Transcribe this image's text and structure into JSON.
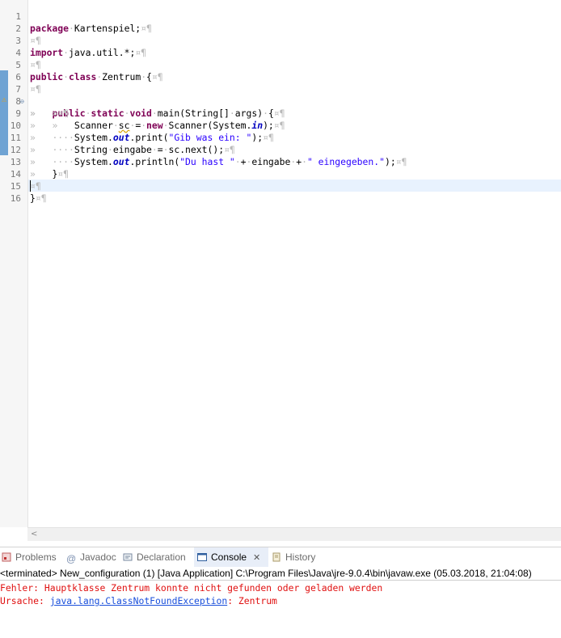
{
  "editor": {
    "lines": [
      {
        "n": "1"
      },
      {
        "n": "2"
      },
      {
        "n": "3"
      },
      {
        "n": "4"
      },
      {
        "n": "5"
      },
      {
        "n": "6"
      },
      {
        "n": "7"
      },
      {
        "n": "8"
      },
      {
        "n": "9"
      },
      {
        "n": "10"
      },
      {
        "n": "11"
      },
      {
        "n": "12"
      },
      {
        "n": "13"
      },
      {
        "n": "14"
      },
      {
        "n": "15"
      },
      {
        "n": "16"
      }
    ],
    "code": {
      "l1_kw": "package",
      "l1_rest": "Kartenspiel;",
      "l3_kw": "import",
      "l3_rest": "java.util.*;",
      "l5_kw1": "public",
      "l5_kw2": "class",
      "l5_rest": "Zentrum",
      "l5_brace": "{",
      "l7_kw1": "public",
      "l7_kw2": "static",
      "l7_kw3": "void",
      "l7_rest": "main(String[]",
      "l7_args": "args)",
      "l7_brace": "{",
      "l9_type": "Scanner",
      "l9_var": "sc",
      "l9_eq": "=",
      "l9_new": "new",
      "l9_ctor": "Scanner(System.",
      "l9_in": "in",
      "l9_end": ");",
      "l10_a": "System.",
      "l10_out": "out",
      "l10_b": ".print(",
      "l10_str": "\"Gib was ein: \"",
      "l10_end": ");",
      "l11_a": "String",
      "l11_b": "eingabe",
      "l11_c": "=",
      "l11_d": "sc.next();",
      "l12_a": "System.",
      "l12_out": "out",
      "l12_b": ".println(",
      "l12_str1": "\"Du hast \"",
      "l12_plus1": "+",
      "l12_var": "eingabe",
      "l12_plus2": "+",
      "l12_str2": "\" eingegeben.\"",
      "l12_end": ");",
      "l13": "}",
      "l15": "}"
    },
    "whitespace": {
      "para": "¶",
      "cr": "¤",
      "tab": "»",
      "dot": "·"
    }
  },
  "panel": {
    "tabs": [
      {
        "label": "Problems",
        "icon": "problems-icon"
      },
      {
        "label": "Javadoc",
        "icon": "javadoc-icon"
      },
      {
        "label": "Declaration",
        "icon": "declaration-icon"
      },
      {
        "label": "Console",
        "icon": "console-icon",
        "active": true
      },
      {
        "label": "History",
        "icon": "history-icon"
      }
    ],
    "close_glyph": "✕",
    "console_header": "<terminated> New_configuration (1) [Java Application] C:\\Program Files\\Java\\jre-9.0.4\\bin\\javaw.exe (05.03.2018, 21:04:08)",
    "output": {
      "line1": "Fehler: Hauptklasse Zentrum konnte nicht gefunden oder geladen werden",
      "line2_prefix": "Ursache: ",
      "line2_link": "java.lang.ClassNotFoundException",
      "line2_suffix": ": Zentrum"
    }
  },
  "colors": {
    "keyword": "#7f0055",
    "string": "#2a00ff",
    "field": "#0000c0",
    "error": "#e01010",
    "link": "#1a4fdb"
  }
}
